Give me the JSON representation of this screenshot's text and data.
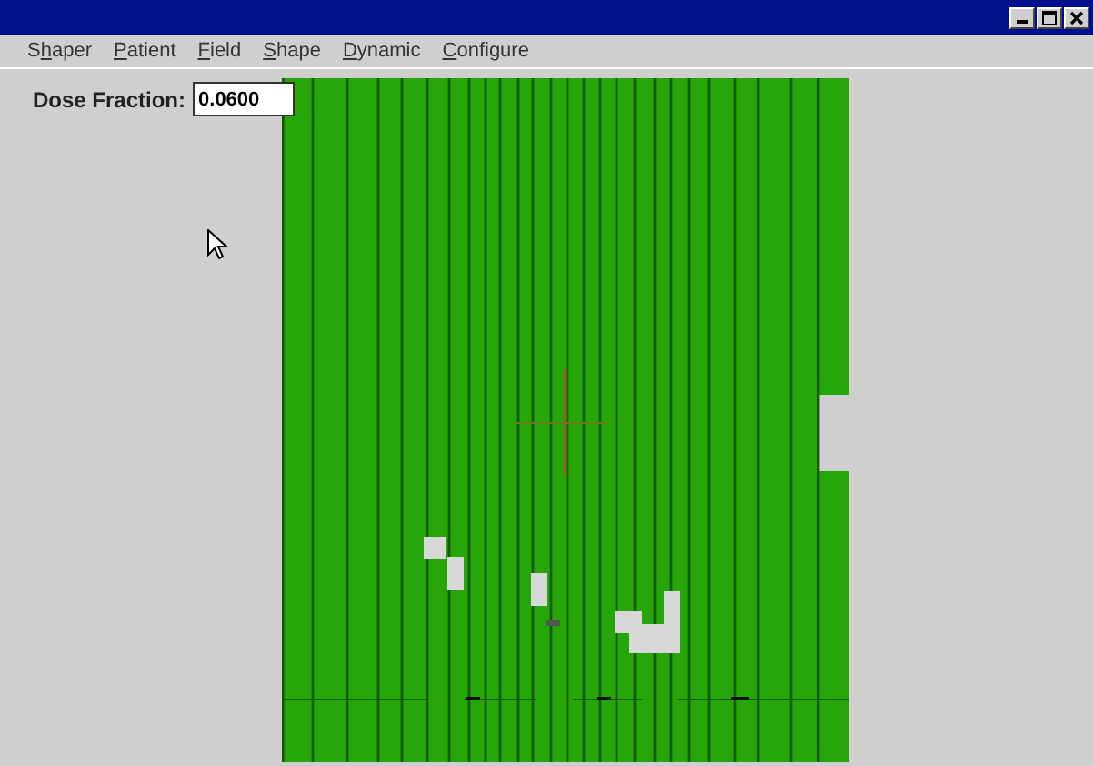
{
  "menu": [
    {
      "prefix": "S",
      "hotkey": "h",
      "rest": "aper"
    },
    {
      "hotkey": "P",
      "rest": "atient"
    },
    {
      "hotkey": "F",
      "rest": "ield"
    },
    {
      "hotkey": "S",
      "rest": "hape"
    },
    {
      "hotkey": "D",
      "rest": "ynamic"
    },
    {
      "hotkey": "C",
      "rest": "onfigure"
    }
  ],
  "dose_fraction": {
    "label": "Dose Fraction:",
    "value": "0.0600"
  }
}
